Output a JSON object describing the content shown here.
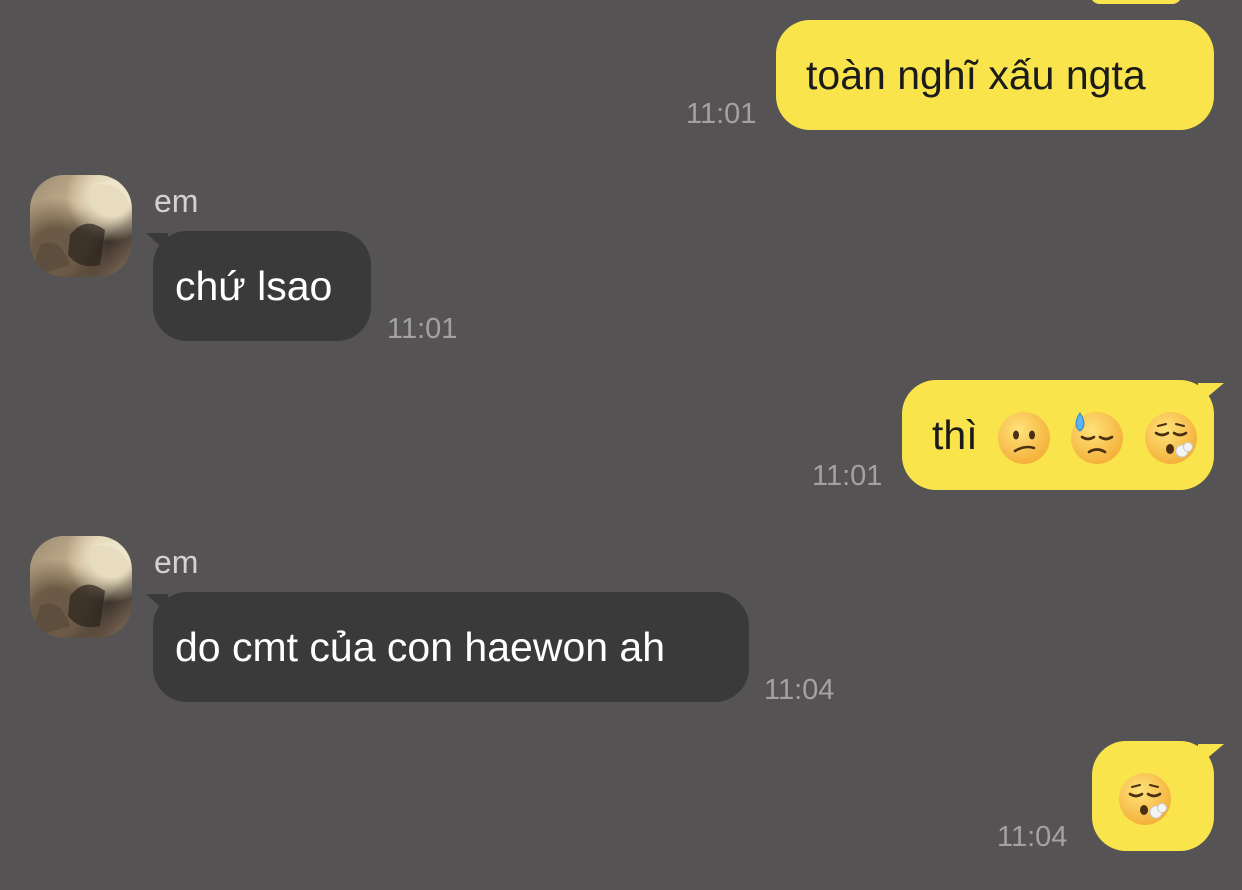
{
  "colors": {
    "background": "#555354",
    "outgoing_bubble": "#f9e54b",
    "incoming_bubble": "#3b3a3b",
    "timestamp": "#a3a1a2"
  },
  "messages": [
    {
      "direction": "outgoing",
      "text": "toàn nghĩ xấu ngta",
      "time": "11:01"
    },
    {
      "direction": "incoming",
      "sender": "em",
      "text": "chứ lsao",
      "time": "11:01"
    },
    {
      "direction": "outgoing",
      "text": "thì",
      "emojis": [
        "confused-face-icon",
        "downcast-face-with-sweat-icon",
        "face-exhaling-icon"
      ],
      "time": "11:01"
    },
    {
      "direction": "incoming",
      "sender": "em",
      "text": "do cmt của con haewon ah",
      "time": "11:04"
    },
    {
      "direction": "outgoing",
      "emojis": [
        "face-exhaling-icon"
      ],
      "time": "11:04"
    }
  ]
}
